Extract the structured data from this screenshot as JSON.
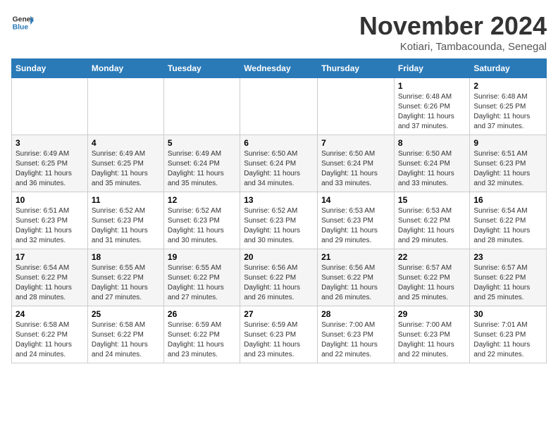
{
  "logo": {
    "line1": "General",
    "line2": "Blue"
  },
  "title": "November 2024",
  "subtitle": "Kotiari, Tambacounda, Senegal",
  "days_of_week": [
    "Sunday",
    "Monday",
    "Tuesday",
    "Wednesday",
    "Thursday",
    "Friday",
    "Saturday"
  ],
  "weeks": [
    [
      {
        "day": "",
        "info": ""
      },
      {
        "day": "",
        "info": ""
      },
      {
        "day": "",
        "info": ""
      },
      {
        "day": "",
        "info": ""
      },
      {
        "day": "",
        "info": ""
      },
      {
        "day": "1",
        "info": "Sunrise: 6:48 AM\nSunset: 6:26 PM\nDaylight: 11 hours and 37 minutes."
      },
      {
        "day": "2",
        "info": "Sunrise: 6:48 AM\nSunset: 6:25 PM\nDaylight: 11 hours and 37 minutes."
      }
    ],
    [
      {
        "day": "3",
        "info": "Sunrise: 6:49 AM\nSunset: 6:25 PM\nDaylight: 11 hours and 36 minutes."
      },
      {
        "day": "4",
        "info": "Sunrise: 6:49 AM\nSunset: 6:25 PM\nDaylight: 11 hours and 35 minutes."
      },
      {
        "day": "5",
        "info": "Sunrise: 6:49 AM\nSunset: 6:24 PM\nDaylight: 11 hours and 35 minutes."
      },
      {
        "day": "6",
        "info": "Sunrise: 6:50 AM\nSunset: 6:24 PM\nDaylight: 11 hours and 34 minutes."
      },
      {
        "day": "7",
        "info": "Sunrise: 6:50 AM\nSunset: 6:24 PM\nDaylight: 11 hours and 33 minutes."
      },
      {
        "day": "8",
        "info": "Sunrise: 6:50 AM\nSunset: 6:24 PM\nDaylight: 11 hours and 33 minutes."
      },
      {
        "day": "9",
        "info": "Sunrise: 6:51 AM\nSunset: 6:23 PM\nDaylight: 11 hours and 32 minutes."
      }
    ],
    [
      {
        "day": "10",
        "info": "Sunrise: 6:51 AM\nSunset: 6:23 PM\nDaylight: 11 hours and 32 minutes."
      },
      {
        "day": "11",
        "info": "Sunrise: 6:52 AM\nSunset: 6:23 PM\nDaylight: 11 hours and 31 minutes."
      },
      {
        "day": "12",
        "info": "Sunrise: 6:52 AM\nSunset: 6:23 PM\nDaylight: 11 hours and 30 minutes."
      },
      {
        "day": "13",
        "info": "Sunrise: 6:52 AM\nSunset: 6:23 PM\nDaylight: 11 hours and 30 minutes."
      },
      {
        "day": "14",
        "info": "Sunrise: 6:53 AM\nSunset: 6:23 PM\nDaylight: 11 hours and 29 minutes."
      },
      {
        "day": "15",
        "info": "Sunrise: 6:53 AM\nSunset: 6:22 PM\nDaylight: 11 hours and 29 minutes."
      },
      {
        "day": "16",
        "info": "Sunrise: 6:54 AM\nSunset: 6:22 PM\nDaylight: 11 hours and 28 minutes."
      }
    ],
    [
      {
        "day": "17",
        "info": "Sunrise: 6:54 AM\nSunset: 6:22 PM\nDaylight: 11 hours and 28 minutes."
      },
      {
        "day": "18",
        "info": "Sunrise: 6:55 AM\nSunset: 6:22 PM\nDaylight: 11 hours and 27 minutes."
      },
      {
        "day": "19",
        "info": "Sunrise: 6:55 AM\nSunset: 6:22 PM\nDaylight: 11 hours and 27 minutes."
      },
      {
        "day": "20",
        "info": "Sunrise: 6:56 AM\nSunset: 6:22 PM\nDaylight: 11 hours and 26 minutes."
      },
      {
        "day": "21",
        "info": "Sunrise: 6:56 AM\nSunset: 6:22 PM\nDaylight: 11 hours and 26 minutes."
      },
      {
        "day": "22",
        "info": "Sunrise: 6:57 AM\nSunset: 6:22 PM\nDaylight: 11 hours and 25 minutes."
      },
      {
        "day": "23",
        "info": "Sunrise: 6:57 AM\nSunset: 6:22 PM\nDaylight: 11 hours and 25 minutes."
      }
    ],
    [
      {
        "day": "24",
        "info": "Sunrise: 6:58 AM\nSunset: 6:22 PM\nDaylight: 11 hours and 24 minutes."
      },
      {
        "day": "25",
        "info": "Sunrise: 6:58 AM\nSunset: 6:22 PM\nDaylight: 11 hours and 24 minutes."
      },
      {
        "day": "26",
        "info": "Sunrise: 6:59 AM\nSunset: 6:22 PM\nDaylight: 11 hours and 23 minutes."
      },
      {
        "day": "27",
        "info": "Sunrise: 6:59 AM\nSunset: 6:23 PM\nDaylight: 11 hours and 23 minutes."
      },
      {
        "day": "28",
        "info": "Sunrise: 7:00 AM\nSunset: 6:23 PM\nDaylight: 11 hours and 22 minutes."
      },
      {
        "day": "29",
        "info": "Sunrise: 7:00 AM\nSunset: 6:23 PM\nDaylight: 11 hours and 22 minutes."
      },
      {
        "day": "30",
        "info": "Sunrise: 7:01 AM\nSunset: 6:23 PM\nDaylight: 11 hours and 22 minutes."
      }
    ]
  ]
}
